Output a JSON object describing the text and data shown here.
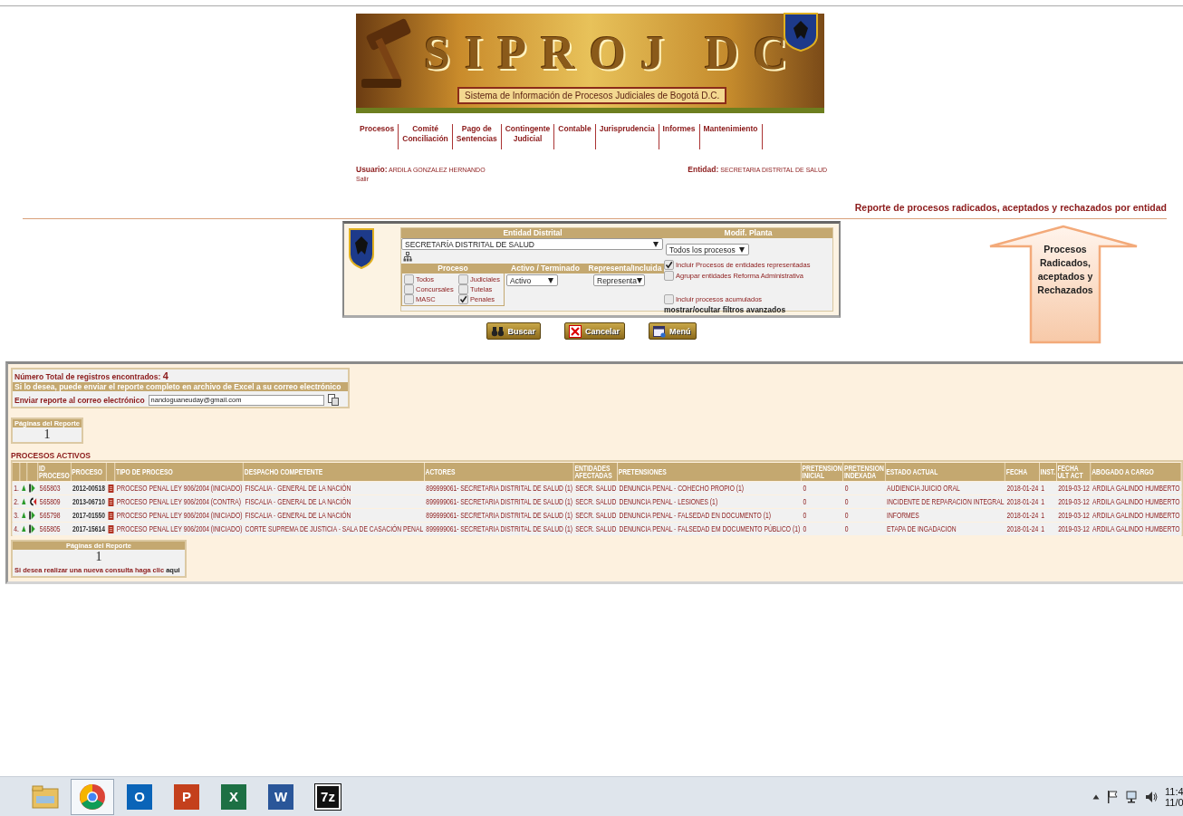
{
  "banner": {
    "logo_text": "SIPROJ DC",
    "subtitle": "Sistema de Información de Procesos Judiciales de Bogotá D.C."
  },
  "nav": [
    {
      "label": "Procesos"
    },
    {
      "label": "Comité\nConciliación"
    },
    {
      "label": "Pago de\nSentencias"
    },
    {
      "label": "Contingente\nJudicial"
    },
    {
      "label": "Contable"
    },
    {
      "label": "Jurisprudencia"
    },
    {
      "label": "Informes"
    },
    {
      "label": "Mantenimiento"
    }
  ],
  "user": {
    "label": "Usuario:",
    "name": "ARDILA GONZALEZ HERNANDO",
    "logout": "Salir"
  },
  "entity": {
    "label": "Entidad:",
    "value": "SECRETARIA DISTRITAL DE SALUD"
  },
  "report_title": "Reporte de procesos radicados, aceptados y rechazados por entidad",
  "callout": {
    "text": "Procesos Radicados, aceptados y Rechazados"
  },
  "filter": {
    "entity_header": "Entidad Distrital",
    "entity_value": "SECRETARÍA DISTRITAL DE SALUD",
    "modif_header": "Modif. Planta",
    "modif_value": "Todos los procesos",
    "proceso_header": "Proceso",
    "activo_header": "Activo / Terminado",
    "representa_header": "Representa/Incluida",
    "activo_value": "Activo",
    "representa_value": "Representa",
    "proceso_options": [
      {
        "label": "Todos",
        "checked": false
      },
      {
        "label": "Judiciales",
        "checked": false
      },
      {
        "label": "Concursales",
        "checked": false
      },
      {
        "label": "Tutelas",
        "checked": false
      },
      {
        "label": "MASC",
        "checked": false
      },
      {
        "label": "Penales",
        "checked": true
      }
    ],
    "options": [
      {
        "label": "Incluir Procesos de entidades representadas",
        "checked": true
      },
      {
        "label": "Agrupar entidades Reforma Administrativa",
        "checked": false
      }
    ],
    "acumulados": {
      "label": "Incluir procesos acumulados",
      "checked": false
    },
    "advanced_link": "mostrar/ocultar filtros avanzados"
  },
  "buttons": [
    {
      "label": "Buscar",
      "kind": "binoculars"
    },
    {
      "label": "Cancelar",
      "kind": "cancel"
    },
    {
      "label": "Menú",
      "kind": "window"
    }
  ],
  "results": {
    "total_label": "Número Total de registros encontrados:",
    "total": "4",
    "email_notice": "Si lo desea, puede enviar el reporte completo en archivo de Excel a su correo electrónico",
    "email_label": "Enviar reporte al correo electrónico",
    "email_value": "nandoguaneuday@gmail.com",
    "pages_label": "Páginas del Reporte",
    "pages": "1",
    "section_title": "PROCESOS ACTIVOS",
    "columns": [
      "ID\nPROCESO",
      "PROCESO",
      "TIPO DE PROCESO",
      "DESPACHO COMPETENTE",
      "ACTORES",
      "ENTIDADES\nAFECTADAS",
      "PRETENSIONES",
      "PRETENSION\nINICIAL",
      "PRETENSION\nINDEXADA",
      "ESTADO ACTUAL",
      "FECHA",
      "INST.",
      "FECHA\nULT ACT",
      "ABOGADO A CARGO"
    ],
    "rows": [
      {
        "n": "1.",
        "kind": "play",
        "id": "565803",
        "proceso": "2012-00518",
        "tipo": "PROCESO PENAL LEY 906/2004 (INICIADO)",
        "despacho": "FISCALIA - GENERAL DE LA NACIÓN",
        "actores": "899999061- SECRETARIA DISTRITAL DE SALUD (1)",
        "entidades": "SECR. SALUD",
        "pretensiones": "DENUNCIA PENAL - COHECHO PROPIO (1)",
        "inicial": "0",
        "indexada": "0",
        "estado": "AUDIENCIA JUICIO ORAL",
        "fecha": "2018-01-24",
        "inst": "1",
        "fecha_ult": "2019-03-12",
        "abogado": "ARDILA GALINDO HUMBERTO"
      },
      {
        "n": "2.",
        "kind": "return",
        "id": "565809",
        "proceso": "2013-06710",
        "tipo": "PROCESO PENAL LEY 906/2004 (CONTRA)",
        "despacho": "FISCALIA - GENERAL DE LA NACIÓN",
        "actores": "899999061- SECRETARIA DISTRITAL DE SALUD (1)",
        "entidades": "SECR. SALUD",
        "pretensiones": "DENUNCIA PENAL - LESIONES (1)",
        "inicial": "0",
        "indexada": "0",
        "estado": "INCIDENTE DE REPARACION INTEGRAL",
        "fecha": "2018-01-24",
        "inst": "1",
        "fecha_ult": "2019-03-12",
        "abogado": "ARDILA GALINDO HUMBERTO"
      },
      {
        "n": "3.",
        "kind": "play",
        "id": "565798",
        "proceso": "2017-01550",
        "tipo": "PROCESO PENAL LEY 906/2004 (INICIADO)",
        "despacho": "FISCALIA - GENERAL DE LA NACIÓN",
        "actores": "899999061- SECRETARIA DISTRITAL DE SALUD (1)",
        "entidades": "SECR. SALUD",
        "pretensiones": "DENUNCIA PENAL - FALSEDAD EN DOCUMENTO (1)",
        "inicial": "0",
        "indexada": "0",
        "estado": "INFORMES",
        "fecha": "2018-01-24",
        "inst": "1",
        "fecha_ult": "2019-03-12",
        "abogado": "ARDILA GALINDO HUMBERTO"
      },
      {
        "n": "4.",
        "kind": "play",
        "id": "565805",
        "proceso": "2017-15614",
        "tipo": "PROCESO PENAL LEY 906/2004 (INICIADO)",
        "despacho": "CORTE SUPREMA DE JUSTICIA - SALA DE CASACIÓN PENAL",
        "actores": "899999061- SECRETARIA DISTRITAL DE SALUD (1)",
        "entidades": "SECR. SALUD",
        "pretensiones": "DENUNCIA PENAL - FALSEDAD EM DOCUMENTO PÚBLICO (1)",
        "inicial": "0",
        "indexada": "0",
        "estado": "ETAPA DE INGADACION",
        "fecha": "2018-01-24",
        "inst": "1",
        "fecha_ult": "2019-03-12",
        "abogado": "ARDILA GALINDO HUMBERTO"
      }
    ],
    "footer_pages_label": "Páginas del Reporte",
    "footer_pages": "1",
    "new_query_text": "Si desea realizar una nueva consulta haga clic",
    "new_query_link": "aqui"
  },
  "taskbar": {
    "apps": [
      {
        "kind": "folder",
        "selected": false
      },
      {
        "kind": "browser",
        "selected": true
      },
      {
        "kind": "mail",
        "glyph": "O",
        "selected": false
      },
      {
        "kind": "slides",
        "glyph": "P",
        "selected": false
      },
      {
        "kind": "sheet",
        "glyph": "X",
        "selected": false
      },
      {
        "kind": "doc",
        "glyph": "W",
        "selected": false
      },
      {
        "kind": "archive",
        "glyph": "7z",
        "selected": false
      }
    ],
    "clock_time": "11:4",
    "clock_date": "11/0"
  }
}
